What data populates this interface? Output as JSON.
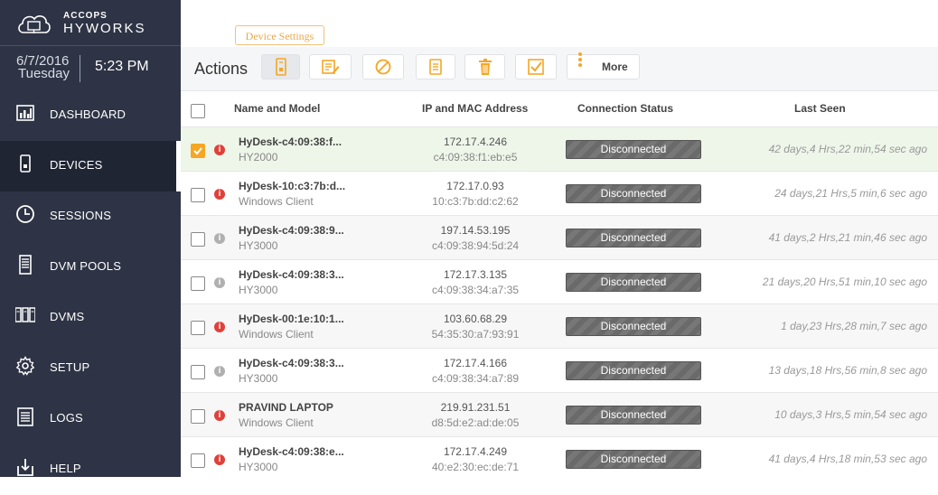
{
  "brand": {
    "top": "ACCOPS",
    "main": "HYWORKS"
  },
  "datetime": {
    "date": "6/7/2016",
    "day": "Tuesday",
    "time": "5:23 PM"
  },
  "nav": [
    {
      "label": "DASHBOARD",
      "icon": "bar-chart-icon",
      "active": false
    },
    {
      "label": "DEVICES",
      "icon": "device-icon",
      "active": true
    },
    {
      "label": "SESSIONS",
      "icon": "clock-icon",
      "active": false
    },
    {
      "label": "DVM POOLS",
      "icon": "server-icon",
      "active": false
    },
    {
      "label": "DVMS",
      "icon": "servers-icon",
      "active": false
    },
    {
      "label": "SETUP",
      "icon": "gear-icon",
      "active": false
    },
    {
      "label": "LOGS",
      "icon": "document-icon",
      "active": false
    },
    {
      "label": "HELP",
      "icon": "download-icon",
      "active": false
    }
  ],
  "toolbar": {
    "tooltip": "Device Settings",
    "title": "Actions",
    "more_label": "More",
    "icons": [
      "device-settings-icon",
      "edit-icon",
      "block-icon",
      "clipboard-icon",
      "trash-icon",
      "check-icon",
      "more-icon"
    ],
    "accent": "#f5a623"
  },
  "table": {
    "headers": [
      "Name and Model",
      "IP and MAC Address",
      "Connection Status",
      "Last Seen"
    ],
    "rows": [
      {
        "name": "HyDesk-c4:09:38:f...",
        "model": "HY2000",
        "ip": "172.17.4.246",
        "mac": "c4:09:38:f1:eb:e5",
        "status": "Disconnected",
        "last_seen": "42 days,4 Hrs,22 min,54 sec ago",
        "checked": true,
        "info": "red"
      },
      {
        "name": "HyDesk-10:c3:7b:d...",
        "model": "Windows Client",
        "ip": "172.17.0.93",
        "mac": "10:c3:7b:dd:c2:62",
        "status": "Disconnected",
        "last_seen": "24 days,21 Hrs,5 min,6 sec ago",
        "checked": false,
        "info": "red"
      },
      {
        "name": "HyDesk-c4:09:38:9...",
        "model": "HY3000",
        "ip": "197.14.53.195",
        "mac": "c4:09:38:94:5d:24",
        "status": "Disconnected",
        "last_seen": "41 days,2 Hrs,21 min,46 sec ago",
        "checked": false,
        "info": "grey"
      },
      {
        "name": "HyDesk-c4:09:38:3...",
        "model": "HY3000",
        "ip": "172.17.3.135",
        "mac": "c4:09:38:34:a7:35",
        "status": "Disconnected",
        "last_seen": "21 days,20 Hrs,51 min,10 sec ago",
        "checked": false,
        "info": "grey"
      },
      {
        "name": "HyDesk-00:1e:10:1...",
        "model": "Windows Client",
        "ip": "103.60.68.29",
        "mac": "54:35:30:a7:93:91",
        "status": "Disconnected",
        "last_seen": "1 day,23 Hrs,28 min,7 sec ago",
        "checked": false,
        "info": "red"
      },
      {
        "name": "HyDesk-c4:09:38:3...",
        "model": "HY3000",
        "ip": "172.17.4.166",
        "mac": "c4:09:38:34:a7:89",
        "status": "Disconnected",
        "last_seen": "13 days,18 Hrs,56 min,8 sec ago",
        "checked": false,
        "info": "grey"
      },
      {
        "name": "PRAVIND LAPTOP",
        "model": "Windows Client",
        "ip": "219.91.231.51",
        "mac": "d8:5d:e2:ad:de:05",
        "status": "Disconnected",
        "last_seen": "10 days,3 Hrs,5 min,54 sec ago",
        "checked": false,
        "info": "red"
      },
      {
        "name": "HyDesk-c4:09:38:e...",
        "model": "HY3000",
        "ip": "172.17.4.249",
        "mac": "40:e2:30:ec:de:71",
        "status": "Disconnected",
        "last_seen": "41 days,4 Hrs,18 min,53 sec ago",
        "checked": false,
        "info": "red"
      }
    ]
  }
}
